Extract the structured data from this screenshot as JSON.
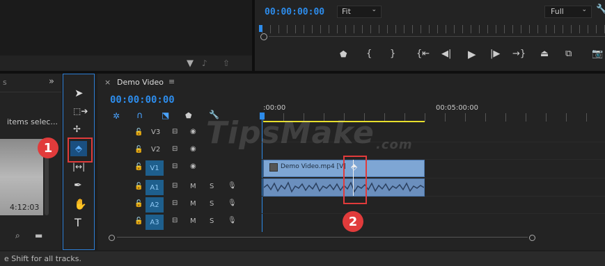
{
  "program_monitor": {
    "timecode": "00:00:00:00",
    "zoom_select": "Fit",
    "quality_select": "Full"
  },
  "project_panel": {
    "items_label": "items selec...",
    "thumb_duration": "4:12:03"
  },
  "sequence": {
    "tab_title": "Demo Video",
    "timecode": "00:00:00:00",
    "ruler_start": ":00:00",
    "ruler_mark": "00:05:00:00",
    "clip_label": "Demo Video.mp4 [V]"
  },
  "tracks": [
    {
      "name": "V3",
      "target": ""
    },
    {
      "name": "V2",
      "target": ""
    },
    {
      "name": "V1",
      "target": "V1"
    },
    {
      "name": "A1",
      "target": "A1",
      "m": "M",
      "s": "S"
    },
    {
      "name": "A2",
      "target": "A2",
      "m": "M",
      "s": "S"
    },
    {
      "name": "A3",
      "target": "A3",
      "m": "M",
      "s": "S"
    }
  ],
  "status_bar": "e Shift for all tracks.",
  "annotations": {
    "badge1": "1",
    "badge2": "2"
  },
  "watermark": {
    "main": "TipsMake",
    "suffix": ".com"
  },
  "colors": {
    "accent": "#2d8ceb",
    "highlight": "#e13b3b",
    "clip": "#7ea6d4"
  }
}
